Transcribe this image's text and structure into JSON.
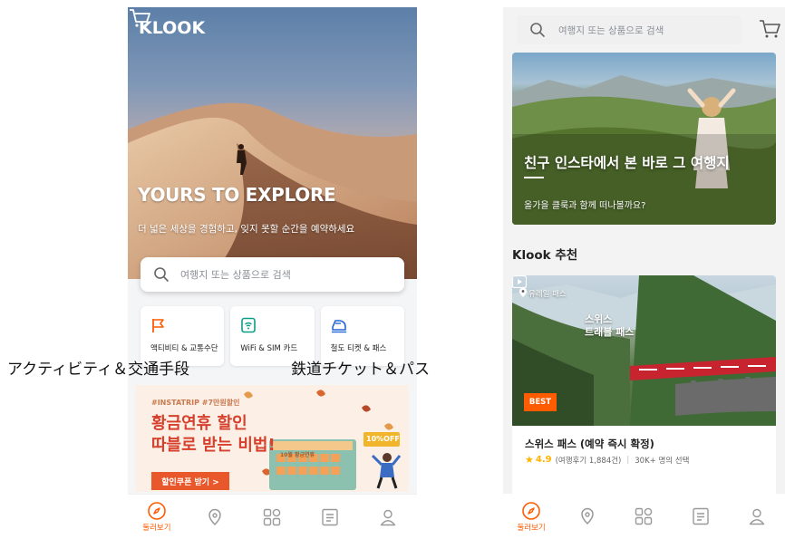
{
  "left_phone": {
    "brand": "KLOOK",
    "hero_title": "YOURS TO EXPLORE",
    "hero_subtitle": "더 넓은 세상을 경험하고, 잊지 못할 순간을 예약하세요",
    "search_placeholder": "여행지 또는 상품으로 검색",
    "categories": [
      {
        "label": "액티비티 & 교통수단",
        "icon": "flag-icon"
      },
      {
        "label": "WiFi & SIM 카드",
        "icon": "wifi-sim-icon"
      },
      {
        "label": "철도 티켓 & 패스",
        "icon": "train-icon"
      }
    ],
    "banner": {
      "tag": "#INSTATRIP #7만원할인",
      "line1": "황금연휴 할인",
      "line2": "따블로 받는 비법!",
      "calendar_title": "10월 황금연휴",
      "calendar_days": [
        "3",
        "4",
        "5",
        "6",
        "7",
        "8",
        "9",
        "10",
        "11",
        "12",
        "13",
        "14"
      ],
      "off_tag": "10%OFF",
      "cta": "할인쿠폰 받기 >"
    },
    "nav": [
      {
        "label": "둘러보기",
        "icon": "compass-icon",
        "active": true
      },
      {
        "label": "",
        "icon": "location-pin-icon",
        "active": false
      },
      {
        "label": "",
        "icon": "grid-icon",
        "active": false
      },
      {
        "label": "",
        "icon": "list-icon",
        "active": false
      },
      {
        "label": "",
        "icon": "user-icon",
        "active": false
      }
    ]
  },
  "captions": {
    "left": "アクティビティ＆交通手段",
    "right": "鉄道チケット＆パス"
  },
  "right_phone": {
    "search_placeholder": "여행지 또는 상품으로 검색",
    "feature_card": {
      "title": "친구 인스타에서 본 바로 그 여행지",
      "subtitle": "올가을 클룩과 함께 떠나볼까요?"
    },
    "section_title": "Klook 추천",
    "product": {
      "location": "유레일 패스",
      "overlay_line1": "스위스",
      "overlay_line2": "트래블 패스",
      "badge": "BEST",
      "name": "스위스 패스 (예약 즉시 확정)",
      "rating": "4.9",
      "reviews": "(여행후기 1,884건)",
      "booked": "30K+ 명의 선택"
    },
    "nav": [
      {
        "label": "둘러보기",
        "icon": "compass-icon",
        "active": true
      },
      {
        "label": "",
        "icon": "location-pin-icon",
        "active": false
      },
      {
        "label": "",
        "icon": "grid-icon",
        "active": false
      },
      {
        "label": "",
        "icon": "list-icon",
        "active": false
      },
      {
        "label": "",
        "icon": "user-icon",
        "active": false
      }
    ]
  },
  "colors": {
    "accent": "#ff5b00",
    "banner_red": "#d6402d"
  }
}
